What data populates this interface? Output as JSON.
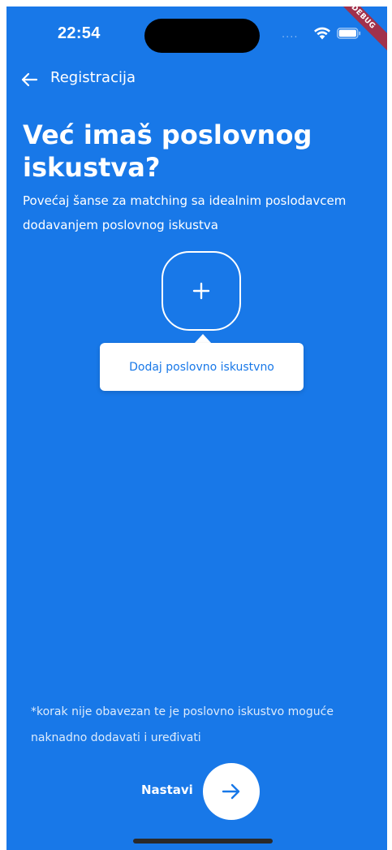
{
  "status_bar": {
    "time": "22:54",
    "signal": "....",
    "wifi_icon": "wifi-icon",
    "battery_icon": "battery-icon"
  },
  "debug_banner": "DEBUG",
  "app_bar": {
    "back_icon": "arrow-left-icon",
    "title": "Registracija"
  },
  "main": {
    "title": "Već imaš poslovnog iskustva?",
    "subtitle": "Povećaj šanse za matching sa idealnim poslodavcem dodavanjem poslovnog iskustva",
    "add_icon": "plus-icon",
    "tooltip_label": "Dodaj poslovno iskustvno"
  },
  "footer": {
    "note": "*korak nije obavezan te je poslovno iskustvo moguće naknadno dodavati i uređivati",
    "continue_label": "Nastavi",
    "continue_icon": "arrow-right-icon"
  },
  "colors": {
    "background": "#1878E8",
    "debug_ribbon": "#A1314B",
    "surface": "#FFFFFF"
  }
}
